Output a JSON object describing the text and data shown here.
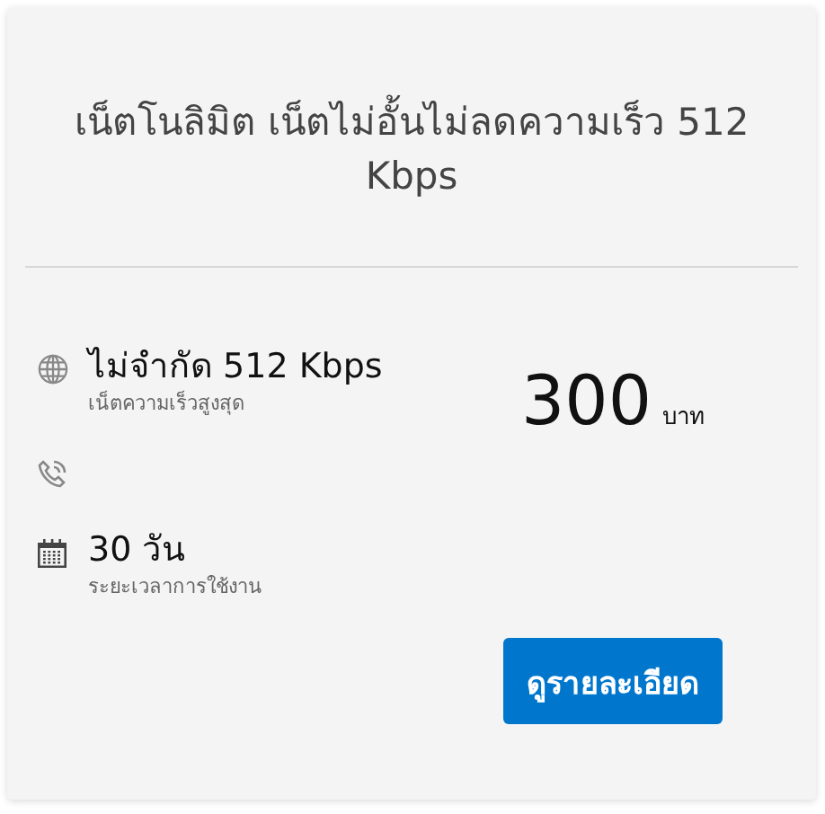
{
  "card": {
    "title": "เน็ตโนลิมิต เน็ตไม่อั้นไม่ลดความเร็ว 512 Kbps",
    "features": [
      {
        "kind": "globe",
        "value": "ไม่จำกัด 512 Kbps",
        "caption": "เน็ตความเร็วสูงสุด"
      },
      {
        "kind": "phone"
      },
      {
        "kind": "calendar",
        "value": "30 วัน",
        "caption": "ระยะเวลาการใช้งาน"
      }
    ],
    "price": {
      "amount": "300",
      "unit": "บาท"
    },
    "button": "ดูรายละเอียด"
  }
}
